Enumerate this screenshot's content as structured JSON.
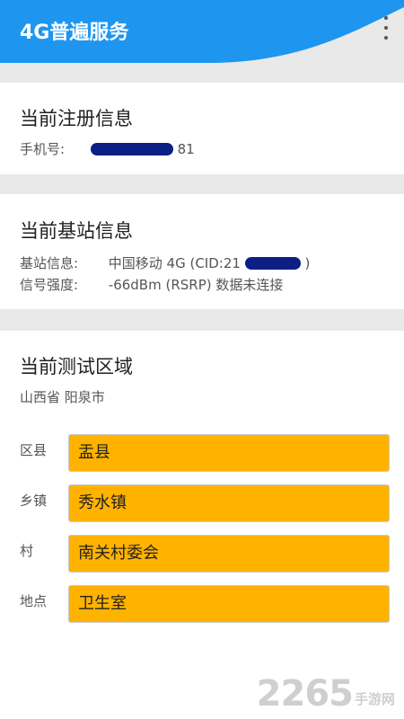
{
  "app": {
    "title": "4G普遍服务"
  },
  "registration": {
    "title": "当前注册信息",
    "phone_label": "手机号:",
    "phone_suffix": "81"
  },
  "base_station": {
    "title": "当前基站信息",
    "info_label": "基站信息:",
    "info_value_prefix": "中国移动 4G (CID:21",
    "info_value_suffix": ")",
    "signal_label": "信号强度:",
    "signal_value": "-66dBm (RSRP) 数据未连接"
  },
  "test_area": {
    "title": "当前测试区域",
    "region": "山西省 阳泉市",
    "fields": [
      {
        "label": "区县",
        "value": "盂县"
      },
      {
        "label": "乡镇",
        "value": "秀水镇"
      },
      {
        "label": "村",
        "value": "南关村委会"
      },
      {
        "label": "地点",
        "value": "卫生室"
      }
    ]
  },
  "watermark": {
    "number": "2265",
    "text": "手游网"
  },
  "colors": {
    "appbar": "#1e96f0",
    "field_bg": "#ffb300",
    "redaction": "#0c1f85",
    "page_bg": "#e9e9e9"
  },
  "icons": {
    "menu": "more-vertical-icon"
  }
}
